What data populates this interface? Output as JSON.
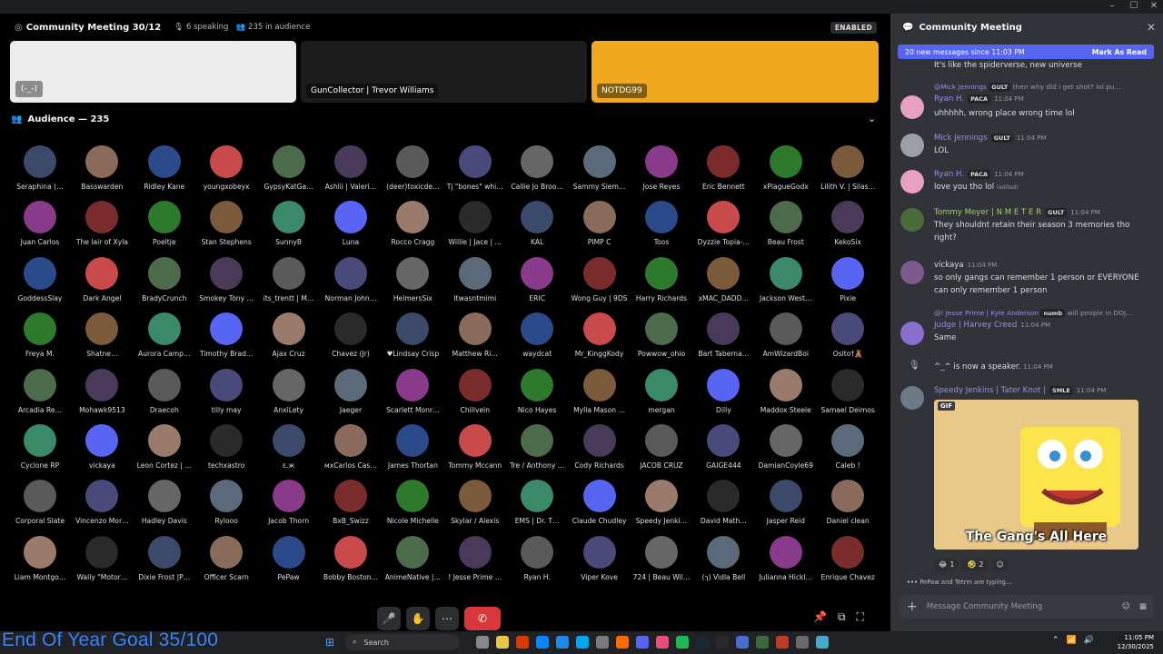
{
  "window": {
    "min": "–",
    "max": "☐",
    "close": "✕"
  },
  "stage": {
    "title": "Community Meeting 30/12",
    "speaking": "6 speaking",
    "audience_count": "235 in audience",
    "badge": "ENABLED",
    "tiles": [
      {
        "label": "",
        "face": "(-_-)"
      },
      {
        "label": "GunCollector | Trevor Williams"
      },
      {
        "label": "NOTDG99"
      }
    ]
  },
  "audience": {
    "header": "Audience — 235",
    "rows": [
      [
        "Seraphina (…",
        "Basswarden",
        "Ridley Kane",
        "youngxobeyx",
        "GypsyKatGa…",
        "Ashlii | Valeri…",
        "(deer)toxicde…",
        "Tj \"bones\" whi…",
        "Callie Jo Broo…",
        "Sammy Siem…",
        "Jose Reyes",
        "Eric Bennett",
        "xPlagueGodx",
        "Lilith V. | Silas…"
      ],
      [
        "Juan Carlos",
        "The lair of Xyla",
        "Poeltje",
        "Stan Stephens",
        "SunnyB",
        "Luna",
        "Rocco Cragg",
        "Willie | Jace | …",
        "KAL",
        "PIMP C",
        "Toos",
        "Dyzzie Topia-…",
        "Beau Frost",
        "KekoSix"
      ],
      [
        "GoddessSlay",
        "Dark Angel",
        "BradyCrunch",
        "Smokey Tony …",
        "its_trentt | M…",
        "Norman John…",
        "HelmersSix",
        "Itwasntmimi",
        "ERIC",
        "Wong Guy | 9DS",
        "Harry Richards",
        "xMAC_DADD…",
        "Jackson West…",
        "Pixie"
      ],
      [
        "Freya M.",
        "Shatne…",
        "Aurora Camp…",
        "Timothy Brad…",
        "Ajax Cruz",
        "Chavez (Jr)",
        "♥Lindsay Crisp",
        "Matthew Ri…",
        "waydcat",
        "Mr_KinggKody",
        "Powwow_ohio",
        "Bart Taberna…",
        "AmWizardBoi",
        "Osito†🧸"
      ],
      [
        "Arcadia Re…",
        "Mohawk9513",
        "Draecoh",
        "tilly may",
        "AnxiLety",
        "Jaeger",
        "Scarlett Monr…",
        "Chillvein",
        "Nico Hayes",
        "Mylla Mason …",
        "mergan",
        "Dilly",
        "Maddox Steele",
        "Samael Deimos"
      ],
      [
        "Cyclone RP",
        "vickaya",
        "Leon Cortez | …",
        "techxastro",
        "ε.ж",
        "мxCarlos Cas…",
        "James Thortan",
        "Tommy Mccann",
        "Tre / Anthony …",
        "Cody Richards",
        "JACOB CRUZ",
        "GAIGE444",
        "DamianCoyle69",
        "Caleb !"
      ],
      [
        "Corporal Slate",
        "Vincenzo Mor…",
        "Hadley Davis",
        "Rylooo",
        "Jacob Thorn",
        "BxB_Swizz",
        "Nicole Michelle",
        "Skylar / Alexis",
        "EMS | Dr. T…",
        "Claude Chudley",
        "Speedy Jenki…",
        "David Math…",
        "Jasper Reid",
        "Daniel clean"
      ],
      [
        "Liam Montgo…",
        "Wally \"Motor…",
        "Dixie Frost |P…",
        "Officer Scarn",
        "PePaw",
        "Bobby Boston…",
        "AnimeNative |…",
        "! Jesse Prime …",
        "Ryan H.",
        "Viper Kove",
        "724 | Beau Wil…",
        "(ך) Vidla Bell",
        "Julianna Hickl…",
        "Enrique Chavez"
      ]
    ]
  },
  "controls": {
    "mute": "🎤",
    "raise": "✋",
    "more": "⋯",
    "leave": "✆",
    "pip": "📌",
    "popout": "⧉",
    "fullscreen": "⛶"
  },
  "chat": {
    "title": "Community Meeting",
    "new_messages": "20 new messages since 11:03 PM",
    "mark_read": "Mark As Read",
    "messages": [
      {
        "text": "It's like the spiderverse, new universe"
      },
      {
        "reply_user": "@Mick Jennings",
        "reply_tag": "GULT",
        "reply_text": "then why did i get shot? lol pu…",
        "user": "Ryan H.",
        "tag": "PACA",
        "time": "11:04 PM",
        "text": "uhhhhh, wrong place wrong time lol"
      },
      {
        "user": "Mick Jennings",
        "tag": "GULT",
        "time": "11:04 PM",
        "text": "LOL"
      },
      {
        "user": "Ryan H.",
        "tag": "PACA",
        "time": "11:04 PM",
        "text": "love you tho lol",
        "edited": "(edited)"
      },
      {
        "user": "Tommy Meyer | N M E T E R",
        "tag": "GULT",
        "time": "11:04 PM",
        "text": "They shouldnt retain their season 3 memories tho right?"
      },
      {
        "user": "vickaya",
        "time": "11:04 PM",
        "text": "so only gangs can remember 1 person or EVERYONE can only remember 1 person"
      },
      {
        "reply_user": "@! Jesse Prime | Kyle Anderson",
        "reply_tag": "numb",
        "reply_text": "will people in DOJ…",
        "user": "Judge | Harvey Creed",
        "time": "11:04 PM",
        "text": "Same"
      },
      {
        "system": "^_^ is now a speaker.",
        "time": "11:04 PM"
      },
      {
        "user": "Speedy Jenkins | Tater Knot |",
        "tag": "SMLE",
        "time": "11:04 PM"
      }
    ],
    "gif_tag": "GIF",
    "gif_caption": "The Gang's All Here",
    "reactions": [
      {
        "emoji": "😂",
        "count": "1"
      },
      {
        "emoji": "🤣",
        "count": "2"
      }
    ],
    "typing": "PePaw and Tetrm are typing…",
    "composer_placeholder": "Message Community Meeting"
  },
  "taskbar": {
    "overlay": "End Of Year Goal 35/100",
    "search": "Search",
    "time": "11:05 PM",
    "date": "12/30/2025"
  },
  "colors": {
    "accent": "#5865f2",
    "danger": "#da373c",
    "speaking_tile": "#f0a81f",
    "goal_text": "#3b82f6"
  }
}
